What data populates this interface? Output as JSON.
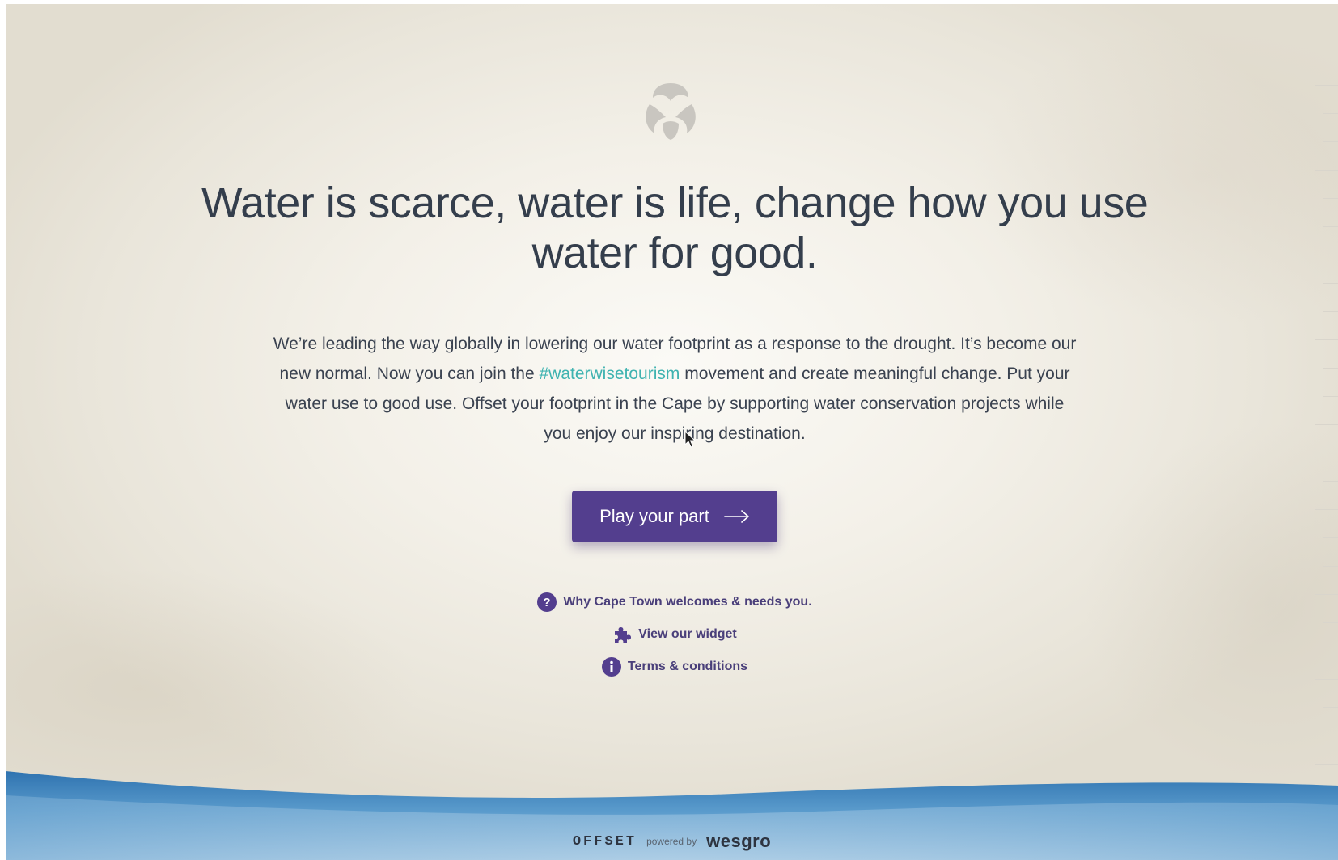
{
  "hero": {
    "logo_icon": "offset-tri-drop-icon",
    "headline": "Water is scarce, water is life, change how you use water for good.",
    "intro_before": "We’re leading the way globally in lowering our water footprint as a response to the drought. It’s become our new normal. Now you can join the ",
    "hashtag": "#waterwisetourism",
    "intro_after": " movement and create meaningful change. Put your water use to good use. Offset your footprint in the Cape by supporting water conservation projects while you enjoy our inspiring destination."
  },
  "cta": {
    "label": "Play your part",
    "icon": "arrow-right-icon"
  },
  "links": [
    {
      "label": "Why Cape Town welcomes & needs you.",
      "icon": "question-circle-icon"
    },
    {
      "label": "View our widget",
      "icon": "puzzle-icon"
    },
    {
      "label": "Terms & conditions",
      "icon": "info-circle-icon"
    }
  ],
  "footer": {
    "brand": "OFFSET",
    "powered_by": "powered by",
    "partner": "wesgro"
  },
  "colors": {
    "accent": "#533e8e",
    "hashtag": "#3fb3b0",
    "text": "#343e4c",
    "water": "#3a7fb8"
  }
}
